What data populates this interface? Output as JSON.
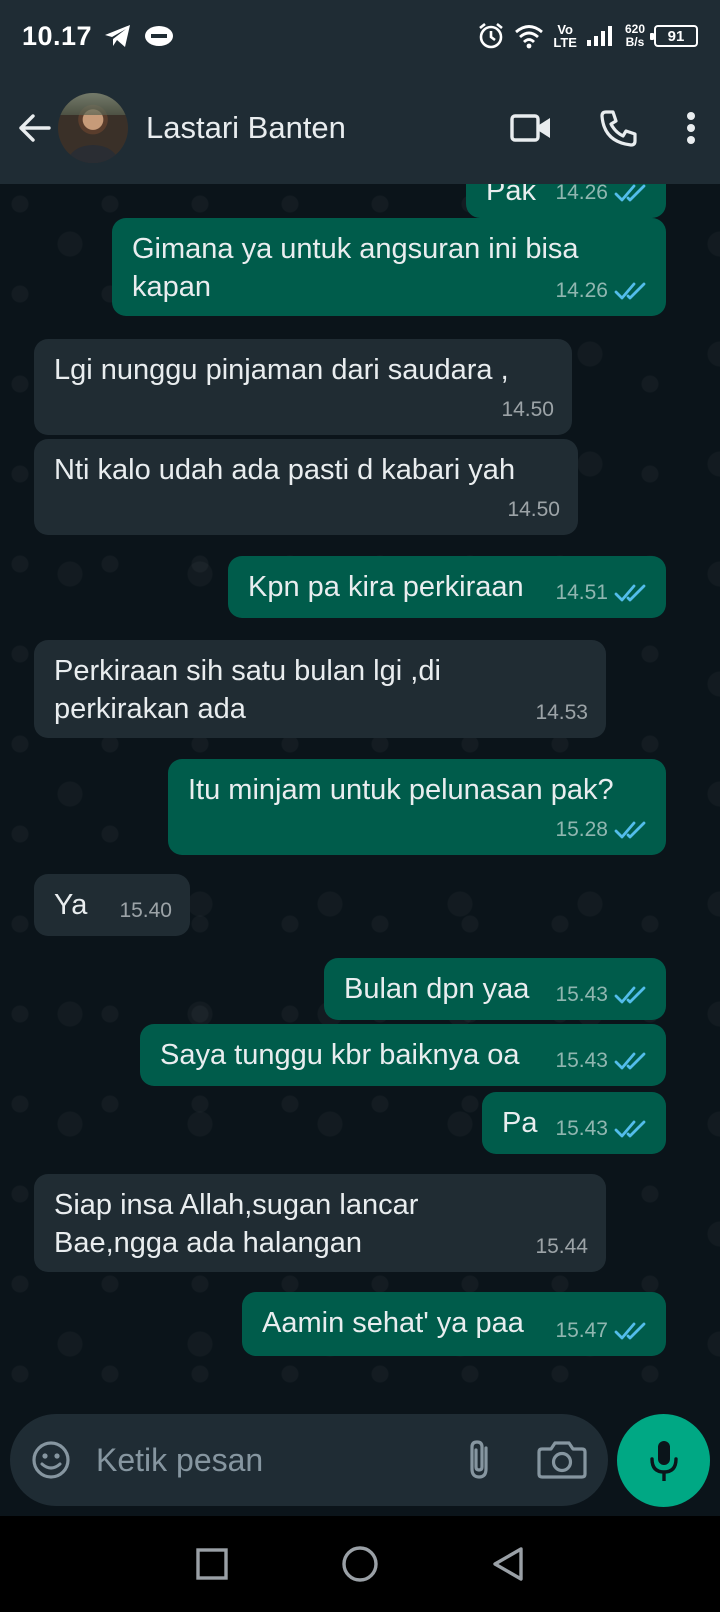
{
  "status_bar": {
    "time": "10.17",
    "network_top": "Vo",
    "network_bottom": "LTE",
    "speed_value": "620",
    "speed_unit": "B/s",
    "battery": "91"
  },
  "header": {
    "contact_name": "Lastari Banten"
  },
  "messages": [
    {
      "side": "out",
      "text": "Pak",
      "time": "14.26",
      "read": true
    },
    {
      "side": "out",
      "text": "Gimana ya untuk angsuran ini bisa kapan",
      "time": "14.26",
      "read": true
    },
    {
      "side": "in",
      "text": "Lgi nunggu pinjaman dari saudara ,",
      "time": "14.50"
    },
    {
      "side": "in",
      "text": "Nti kalo udah ada pasti d kabari yah",
      "time": "14.50"
    },
    {
      "side": "out",
      "text": "Kpn pa kira perkiraan",
      "time": "14.51",
      "read": true
    },
    {
      "side": "in",
      "text": "Perkiraan sih satu bulan lgi ,di perkirakan ada",
      "time": "14.53"
    },
    {
      "side": "out",
      "text": "Itu minjam untuk pelunasan pak?",
      "time": "15.28",
      "read": true
    },
    {
      "side": "in",
      "text": "Ya",
      "time": "15.40"
    },
    {
      "side": "out",
      "text": "Bulan dpn yaa",
      "time": "15.43",
      "read": true
    },
    {
      "side": "out",
      "text": "Saya tunggu kbr baiknya oa",
      "time": "15.43",
      "read": true
    },
    {
      "side": "out",
      "text": "Pa",
      "time": "15.43",
      "read": true
    },
    {
      "side": "in",
      "text": "Siap insa Allah,sugan lancar Bae,ngga ada halangan",
      "time": "15.44"
    },
    {
      "side": "out",
      "text": "Aamin sehat' ya paa",
      "time": "15.47",
      "read": true
    }
  ],
  "input": {
    "placeholder": "Ketik pesan"
  },
  "colors": {
    "outgoing_bubble": "#005c4b",
    "incoming_bubble": "#202c33",
    "accent": "#00a884",
    "read_tick": "#53bdeb",
    "background": "#0b141a"
  }
}
